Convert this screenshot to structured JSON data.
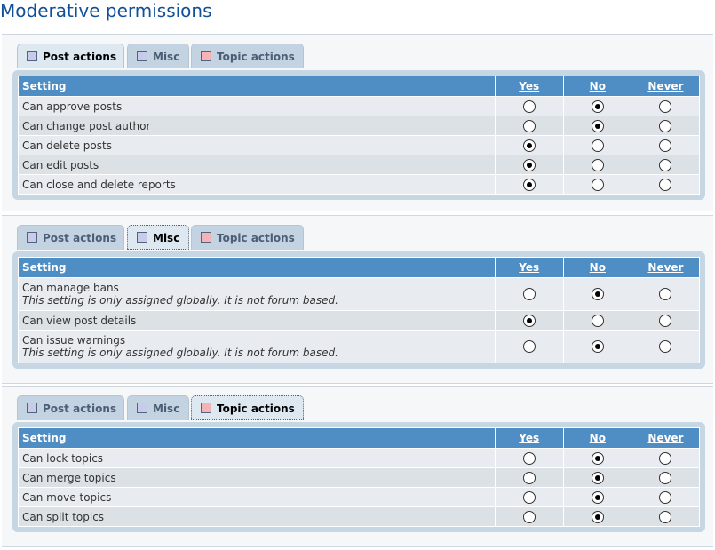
{
  "page": {
    "title": "Moderative permissions"
  },
  "tab_labels": [
    "Post actions",
    "Misc",
    "Topic actions"
  ],
  "headers": {
    "setting": "Setting",
    "yes": "Yes",
    "no": "No",
    "never": "Never"
  },
  "colors": {
    "swatch_blue": "#c8cce8",
    "swatch_red": "#f5b3b8",
    "header_bg": "#4e8ec5"
  },
  "panels": [
    {
      "active_tab": "Post actions",
      "rows": [
        {
          "label": "Can approve posts",
          "note": "",
          "value": "No"
        },
        {
          "label": "Can change post author",
          "note": "",
          "value": "No"
        },
        {
          "label": "Can delete posts",
          "note": "",
          "value": "Yes"
        },
        {
          "label": "Can edit posts",
          "note": "",
          "value": "Yes"
        },
        {
          "label": "Can close and delete reports",
          "note": "",
          "value": "Yes"
        }
      ]
    },
    {
      "active_tab": "Misc",
      "rows": [
        {
          "label": "Can manage bans",
          "note": "This setting is only assigned globally. It is not forum based.",
          "value": "No"
        },
        {
          "label": "Can view post details",
          "note": "",
          "value": "Yes"
        },
        {
          "label": "Can issue warnings",
          "note": "This setting is only assigned globally. It is not forum based.",
          "value": "No"
        }
      ]
    },
    {
      "active_tab": "Topic actions",
      "rows": [
        {
          "label": "Can lock topics",
          "note": "",
          "value": "No"
        },
        {
          "label": "Can merge topics",
          "note": "",
          "value": "No"
        },
        {
          "label": "Can move topics",
          "note": "",
          "value": "No"
        },
        {
          "label": "Can split topics",
          "note": "",
          "value": "No"
        }
      ]
    }
  ]
}
